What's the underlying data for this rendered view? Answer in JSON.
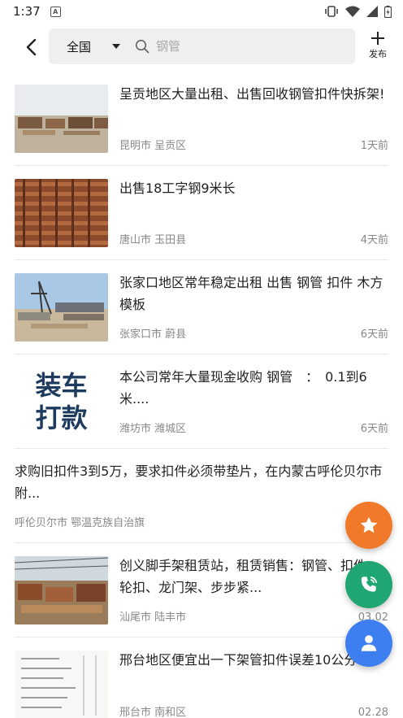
{
  "status_bar": {
    "time": "1:37",
    "notification_icon": "A"
  },
  "header": {
    "region": "全国",
    "search_placeholder": "钢管",
    "publish_label": "发布"
  },
  "listings": [
    {
      "title": "呈贡地区大量出租、出售回收钢管扣件快拆架!",
      "location": "昆明市 呈贡区",
      "time": "1天前",
      "thumb": "yard"
    },
    {
      "title": "出售18工字钢9米长",
      "location": "唐山市 玉田县",
      "time": "4天前",
      "thumb": "steel"
    },
    {
      "title": "张家口地区常年稳定出租 出售 钢管 扣件 木方 模板",
      "location": "张家口市 蔚县",
      "time": "6天前",
      "thumb": "crane"
    },
    {
      "title": "本公司常年大量现金收购 钢管　：　0.1到6米....",
      "location": "潍坊市 潍城区",
      "time": "6天前",
      "thumb": "text",
      "thumb_text_1": "装车",
      "thumb_text_2": "打款"
    },
    {
      "title": "求购旧扣件3到5万，要求扣件必须带垫片，在内蒙古呼伦贝尔市附...",
      "location": "呼伦贝尔市 鄂温克族自治旗",
      "time": "",
      "thumb": "none"
    },
    {
      "title": "创义脚手架租赁站，租赁销售：钢管、扣件、轮扣、龙门架、步步紧...",
      "location": "汕尾市 陆丰市",
      "time": "03.02",
      "thumb": "site"
    },
    {
      "title": "邢台地区便宜出一下架管扣件误差10公分",
      "location": "邢台市 南和区",
      "time": "02.28",
      "thumb": "paper"
    }
  ],
  "colors": {
    "fab_star": "#f07a2a",
    "fab_phone": "#1fa673",
    "fab_user": "#3d7ff0"
  },
  "fabs": [
    "star-icon",
    "phone-icon",
    "user-icon"
  ]
}
